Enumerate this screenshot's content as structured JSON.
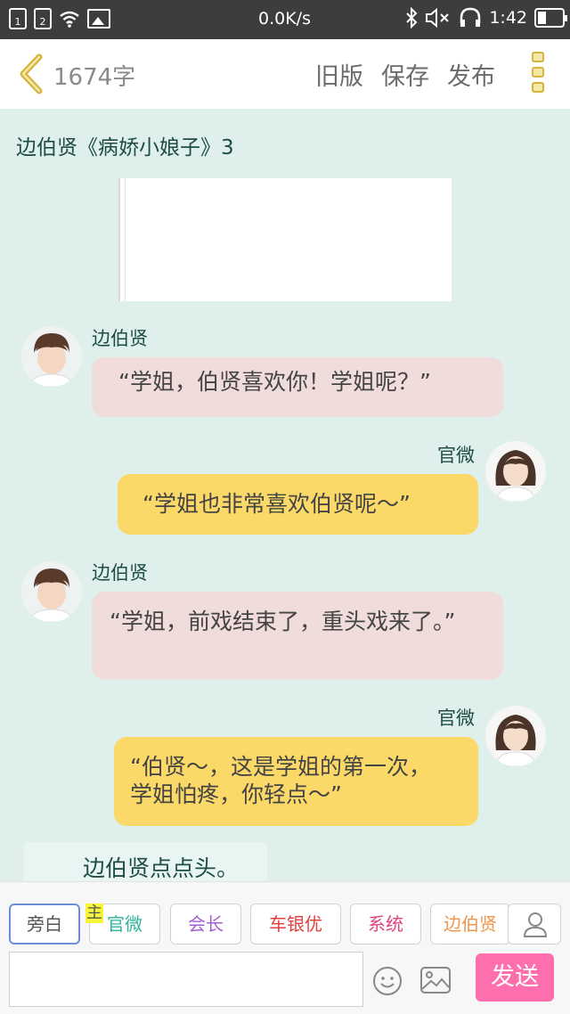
{
  "statusbar": {
    "sim1": "1",
    "sim2": "2",
    "speed": "0.0K/s",
    "time": "1:42"
  },
  "header": {
    "word_count": "1674字",
    "old_version": "旧版",
    "save": "保存",
    "publish": "发布"
  },
  "story_title": "边伯贤《病娇小娘子》3",
  "messages": [
    {
      "name": "边伯贤",
      "text": "“学姐，伯贤喜欢你！学姐呢？”",
      "side": "left",
      "color": "#f1dcdc"
    },
    {
      "name": "官微",
      "text": "“学姐也非常喜欢伯贤呢～”",
      "side": "right",
      "color": "#fbd968"
    },
    {
      "name": "边伯贤",
      "text": "“学姐，前戏结束了，重头戏来了。”",
      "side": "left",
      "color": "#f1dcdc"
    },
    {
      "name": "官微",
      "text": "“伯贤～，这是学姐的第一次，学姐怕疼，你轻点～”",
      "side": "right",
      "color": "#fbd968"
    }
  ],
  "narration": "边伯贤点点头。",
  "roles": [
    {
      "label": "旁白",
      "color": "#555555"
    },
    {
      "label": "官微",
      "color": "#2fb39a"
    },
    {
      "label": "会长",
      "color": "#a45fd0"
    },
    {
      "label": "车银优",
      "color": "#e0413a"
    },
    {
      "label": "系统",
      "color": "#e0437e"
    },
    {
      "label": "边伯贤",
      "color": "#f0954a"
    }
  ],
  "main_mark": "主",
  "input": {
    "value": "",
    "placeholder": ""
  },
  "send_label": "发送",
  "icons": {
    "back": "chevron-left-icon",
    "menu": "more-icon",
    "emoji": "smiley-icon",
    "image": "image-icon",
    "person": "person-icon"
  },
  "colors": {
    "accent": "#d4b43a",
    "send": "#ff6fae",
    "background": "#dff0ec"
  }
}
